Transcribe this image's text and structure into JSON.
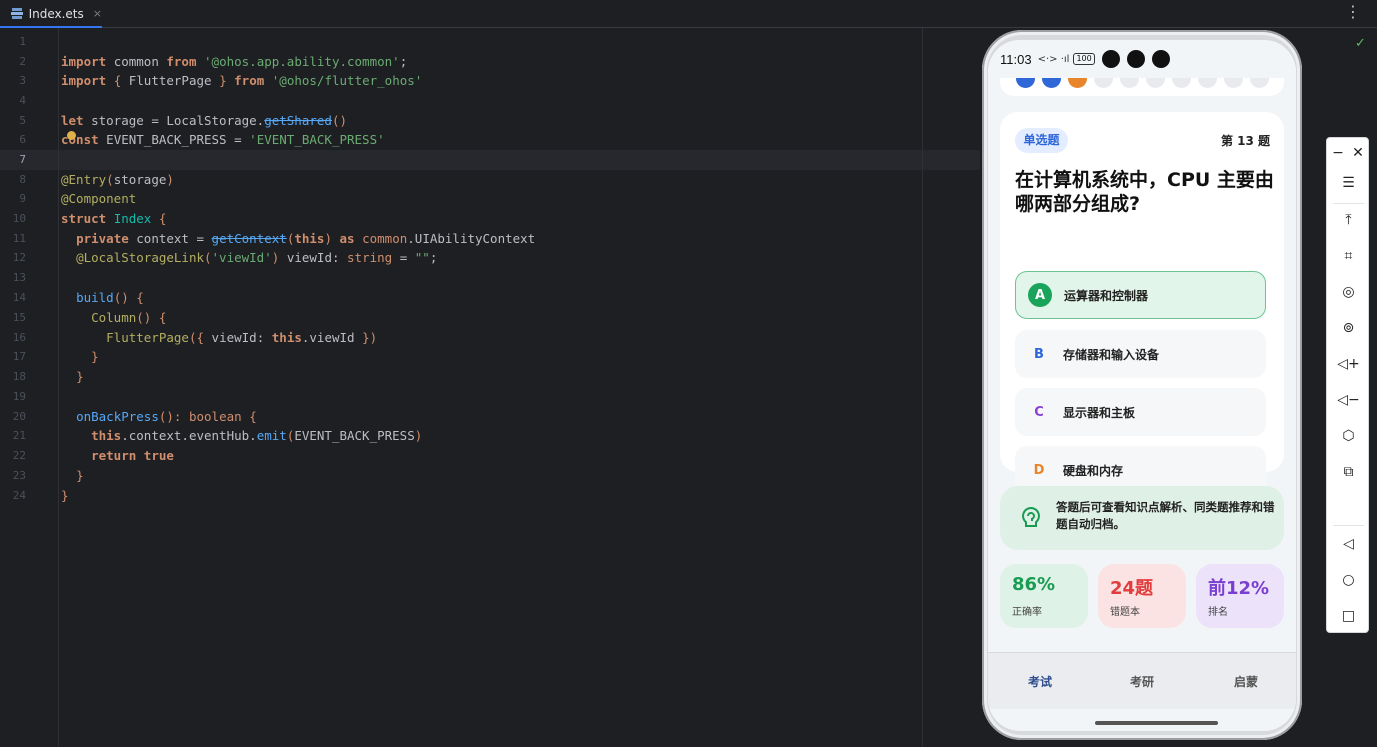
{
  "tabs": [
    {
      "label": "Index.ets",
      "close": "×"
    }
  ],
  "more_icon": "⋮",
  "editor": {
    "line_numbers": [
      "1",
      "2",
      "3",
      "4",
      "5",
      "6",
      "7",
      "8",
      "9",
      "10",
      "11",
      "12",
      "13",
      "14",
      "15",
      "16",
      "17",
      "18",
      "19",
      "20",
      "21",
      "22",
      "23",
      "24"
    ],
    "current_line": "7"
  },
  "phone": {
    "status": {
      "time": "11:03",
      "battery": "100"
    },
    "question": {
      "badge": "单选题",
      "number": "第 13 题",
      "text": "在计算机系统中，CPU 主要由哪两部分组成?",
      "options": [
        {
          "letter": "A",
          "text": "运算器和控制器",
          "selected": true,
          "color": "#1aa35a"
        },
        {
          "letter": "B",
          "text": "存储器和输入设备",
          "selected": false,
          "color": "#2f67d8"
        },
        {
          "letter": "C",
          "text": "显示器和主板",
          "selected": false,
          "color": "#8a3fd1"
        },
        {
          "letter": "D",
          "text": "硬盘和内存",
          "selected": false,
          "color": "#e8852a"
        }
      ]
    },
    "tip": "答题后可查看知识点解析、同类题推荐和错题自动归档。",
    "stats": [
      {
        "value": "86%",
        "label": "正确率",
        "color": "#1a9b52",
        "bg": "#dff2e7"
      },
      {
        "value": "24题",
        "label": "错题本",
        "color": "#e23c3c",
        "bg": "#fbe3e3"
      },
      {
        "value": "前12%",
        "label": "排名",
        "color": "#7a3fd0",
        "bg": "#ece3fb"
      }
    ],
    "nav": [
      "考试",
      "考研",
      "启蒙"
    ]
  },
  "sidebar_tools": [
    "minimize-icon",
    "close-icon",
    "menu-icon",
    "pin-top-icon",
    "crop-icon",
    "rotate-icon",
    "record-icon",
    "volume-up-icon",
    "volume-down-icon",
    "fold-icon",
    "multi-device-icon",
    "back-icon",
    "home-icon",
    "recents-icon"
  ]
}
